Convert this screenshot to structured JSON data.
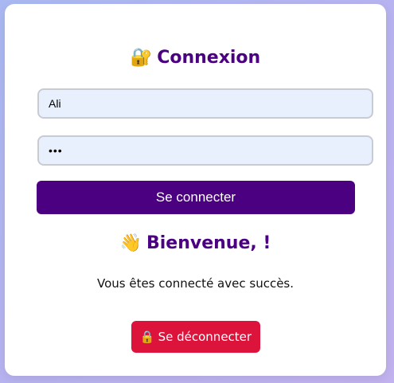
{
  "login": {
    "title_icon": "🔐",
    "title": "Connexion",
    "username_value": "Ali",
    "password_value": "•••",
    "submit_label": "Se connecter"
  },
  "welcome": {
    "icon": "👋",
    "heading": "Bienvenue, !",
    "message": "Vous êtes connecté avec succès.",
    "logout_icon": "🔒",
    "logout_label": "Se déconnecter"
  },
  "colors": {
    "primary": "#4b0082",
    "danger": "#dc143c",
    "input_bg": "#e8f0fe"
  }
}
